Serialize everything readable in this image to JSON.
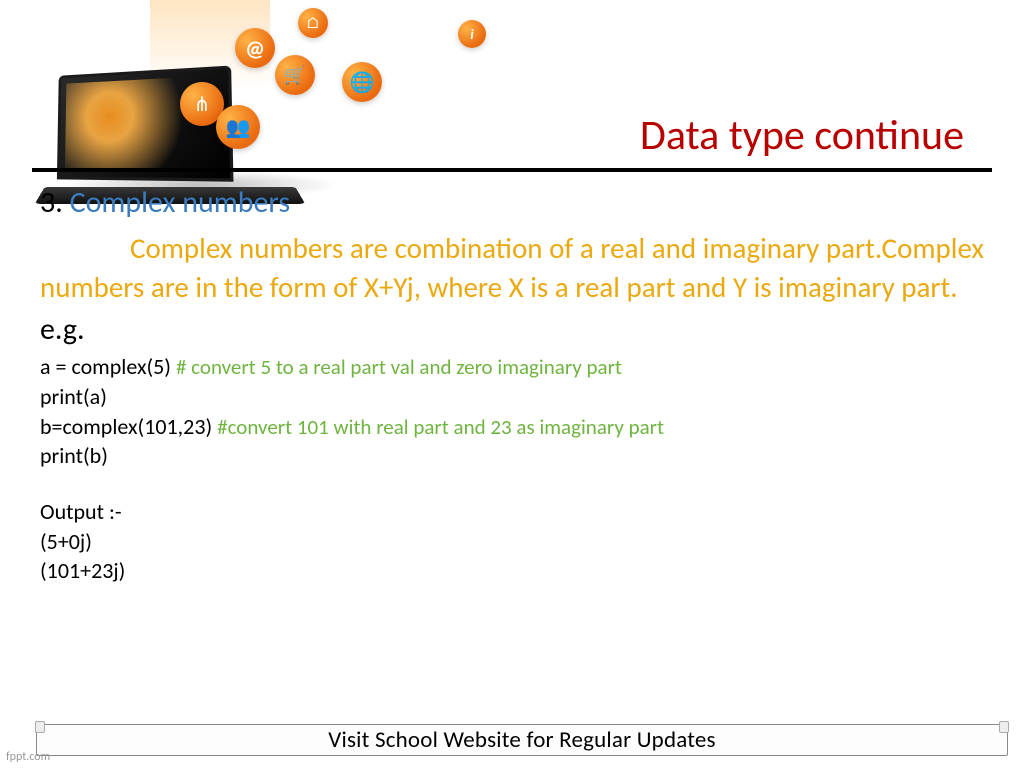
{
  "title": "Data type continue",
  "section": {
    "number": "3.",
    "heading": "Complex numbers"
  },
  "body": "Complex numbers are combination of a real and imaginary part.Complex numbers are in the form of X+Yj, where X is a real part and Y is imaginary part.",
  "eg_label": "e.g.",
  "code": {
    "line1_code": "a = complex(5) ",
    "line1_comment": "# convert 5 to a real part val and zero imaginary part",
    "line2": "print(a)",
    "line3_code": "b=complex(101,23) ",
    "line3_comment": "#convert 101 with real part and 23 as imaginary part",
    "line4": "print(b)",
    "output_label": "Output :-",
    "out1": "(5+0j)",
    "out2": "(101+23j)"
  },
  "footer": "Visit School Website for Regular Updates",
  "watermark": "fppt.com",
  "icons": {
    "network": "⋔",
    "people": "👥",
    "at": "@",
    "cart": "🛒",
    "home": "⌂",
    "globe": "🌐",
    "info": "i"
  }
}
